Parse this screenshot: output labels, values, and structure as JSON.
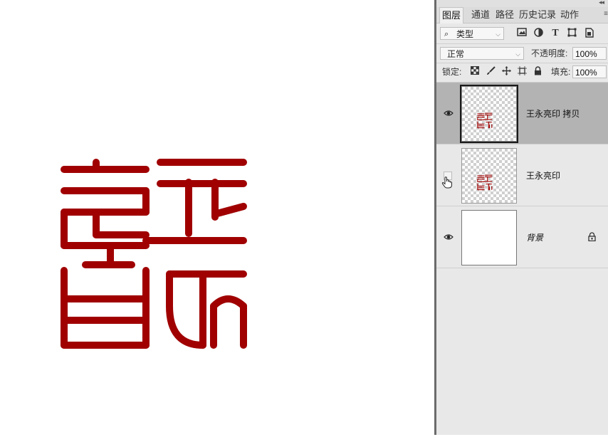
{
  "panel": {
    "tabs": [
      {
        "label": "图层",
        "active": true
      },
      {
        "label": "通道"
      },
      {
        "label": "路径"
      },
      {
        "label": "历史记录"
      },
      {
        "label": "动作"
      }
    ],
    "filter": {
      "kind_label": "类型"
    },
    "blend": {
      "mode": "正常",
      "opacity_label": "不透明度:",
      "opacity_value": "100%"
    },
    "lock": {
      "label": "锁定:",
      "fill_label": "填充:",
      "fill_value": "100%"
    },
    "layers": [
      {
        "name": "王永亮印 拷贝",
        "visible": true,
        "selected": true
      },
      {
        "name": "王永亮印",
        "visible": false,
        "selected": false
      },
      {
        "name": "背景",
        "visible": true,
        "locked": true
      }
    ]
  },
  "artwork": {
    "seal_color": "#a00000"
  },
  "colors": {
    "panel_bg": "#e8e8e8",
    "selected_layer": "#b3b3b3"
  }
}
